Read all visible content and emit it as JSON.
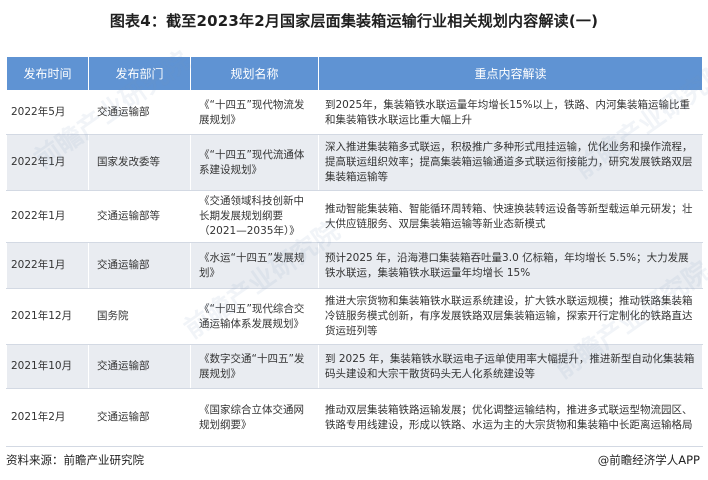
{
  "title": "图表4：截至2023年2月国家层面集装箱运输行业相关规划内容解读(一)",
  "table": {
    "headers": [
      "发布时间",
      "发布部门",
      "规划名称",
      "重点内容解读"
    ],
    "rows": [
      {
        "date": "2022年5月",
        "dept": "交通运输部",
        "plan": "《“十四五”现代物流发展规划》",
        "content": "到2025年，集装箱铁水联运量年均增长15%以上，铁路、内河集装箱运输比重和集装箱铁水联运比重大幅上升"
      },
      {
        "date": "2022年1月",
        "dept": "国家发改委等",
        "plan": "《“十四五”现代流通体系建设规划》",
        "content": "深入推进集装箱多式联运，积极推广多种形式甩挂运输，优化业务和操作流程，提高联运组织效率；提高集装箱运输通道多式联运衔接能力，研究发展铁路双层集装箱运输等"
      },
      {
        "date": "2022年1月",
        "dept": "交通运输部等",
        "plan": "《交通领域科技创新中长期发展规划纲要（2021—2035年）》",
        "content": "推动智能集装箱、智能循环周转箱、快速换装转运设备等新型载运单元研发；壮大供应链服务、双层集装箱运输等新业态新模式"
      },
      {
        "date": "2022年1月",
        "dept": "交通运输部",
        "plan": "《水运“十四五”发展规划》",
        "content": "预计2025 年，沿海港口集装箱吞吐量3.0 亿标箱，年均增长 5.5%；大力发展铁水联运，集装箱铁水联运量年均增长 15%"
      },
      {
        "date": "2021年12月",
        "dept": "国务院",
        "plan": "《“十四五”现代综合交通运输体系发展规划》",
        "content": "推进大宗货物和集装箱铁水联运系统建设，扩大铁水联运规模；推动铁路集装箱冷链服务模式创新，有序发展铁路双层集装箱运输，探索开行定制化的铁路直达货运班列等"
      },
      {
        "date": "2021年10月",
        "dept": "交通运输部",
        "plan": "《数字交通“十四五”发展规划》",
        "content": "到 2025 年，集装箱铁水联运电子运单使用率大幅提升，推进新型自动化集装箱码头建设和大宗干散货码头无人化系统建设等"
      },
      {
        "date": "2021年2月",
        "dept": "交通运输部",
        "plan": "《国家综合立体交通网规划纲要》",
        "content": "推动双层集装箱铁路运输发展；优化调整运输结构，推进多式联运型物流园区、铁路专用线建设，形成以铁路、水运为主的大宗货物和集装箱中长距离运输格局"
      }
    ]
  },
  "watermark_text": "前瞻产业研究院",
  "footer": {
    "source": "资料来源：前瞻产业研究院",
    "copyright": "@前瞻经济学人APP"
  }
}
